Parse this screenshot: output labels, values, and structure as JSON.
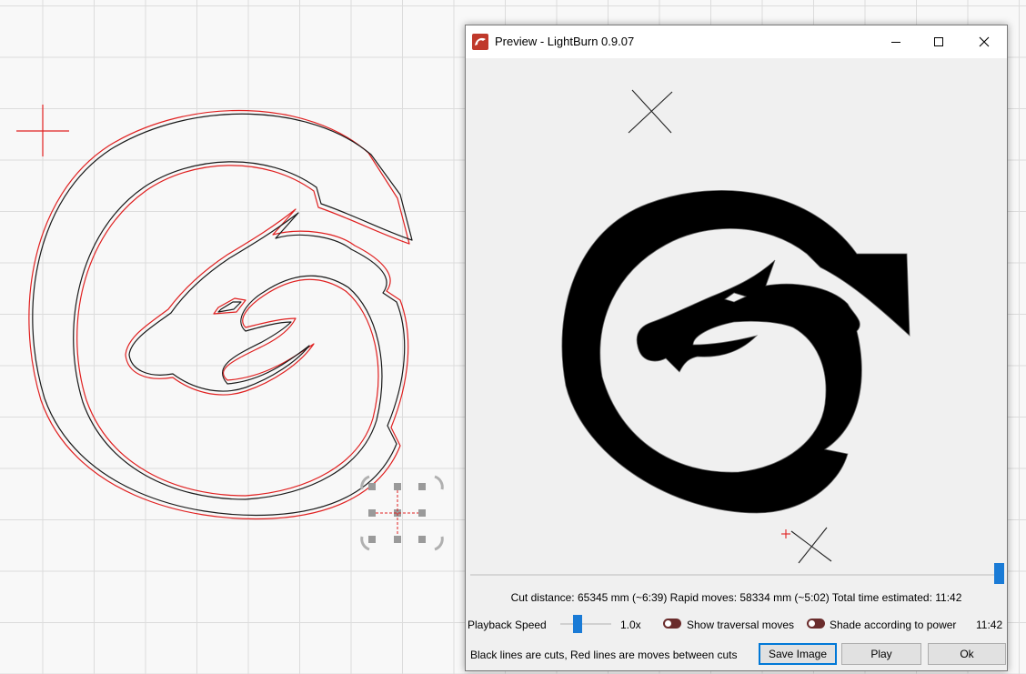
{
  "window": {
    "title": "Preview - LightBurn 0.9.07",
    "app_icon": "lightburn-logo-icon",
    "minimize_icon": "minimize-icon",
    "maximize_icon": "maximize-icon",
    "close_icon": "close-icon"
  },
  "stats": {
    "text": "Cut distance: 65345 mm (~6:39)  Rapid moves: 58334 mm (~5:02)  Total time estimated: 11:42"
  },
  "controls": {
    "playback_speed_label": "Playback Speed",
    "playback_speed_value": "1.0x",
    "traversal_label": "Show traversal moves",
    "shade_label": "Shade according to power",
    "time_label": "11:42",
    "traversal_enabled": true,
    "shade_enabled": true
  },
  "progress": {
    "playback_position": 1.0
  },
  "buttons": {
    "note": "Black lines are cuts, Red lines are moves between cuts",
    "save": "Save Image",
    "play": "Play",
    "ok": "Ok"
  },
  "colors": {
    "accent": "#1a7bd6",
    "toggle": "#6a2c2c",
    "cut_line": "#000000",
    "move_line": "#e02020"
  }
}
